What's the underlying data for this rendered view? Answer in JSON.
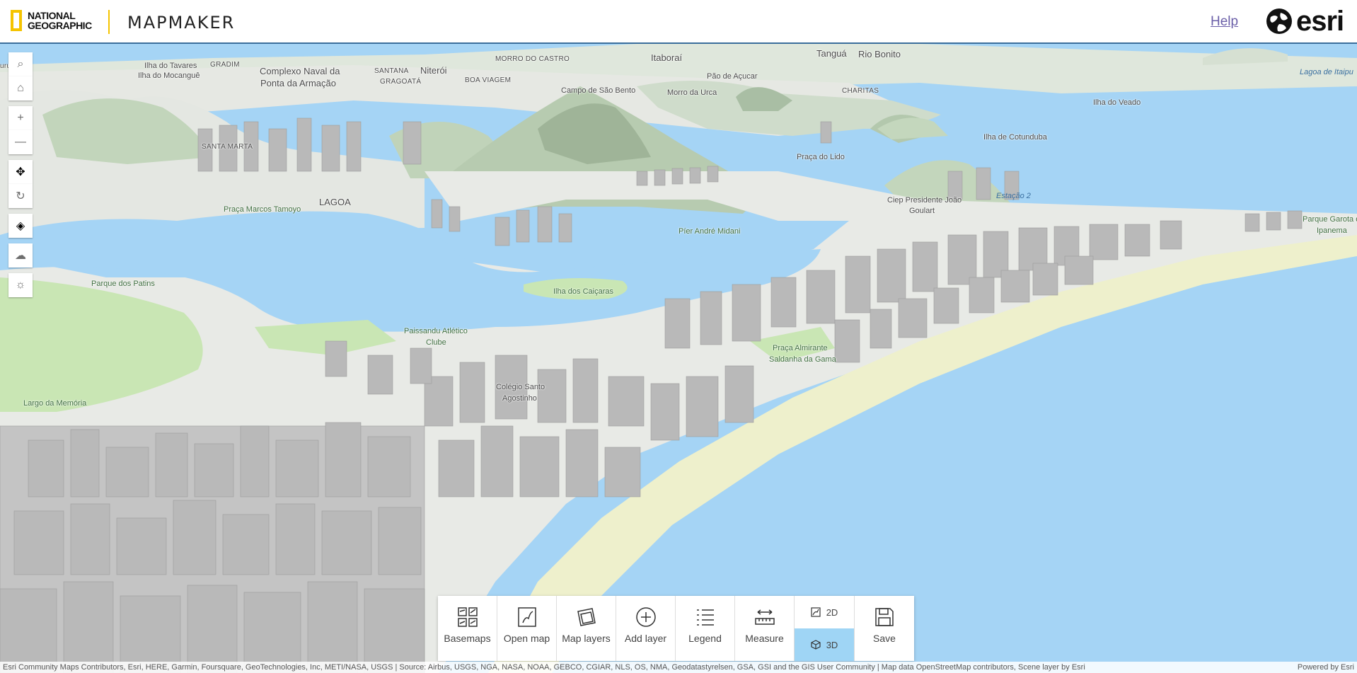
{
  "header": {
    "ng_line1": "NATIONAL",
    "ng_line2": "GEOGRAPHIC",
    "app_title": "MAPMAKER",
    "help_link": "Help",
    "esri_text": "esri"
  },
  "nav_tools": [
    {
      "name": "search-icon",
      "glyph": "⌕"
    },
    {
      "name": "home-icon",
      "glyph": "⌂"
    },
    {
      "name": "zoom-in-icon",
      "glyph": "+"
    },
    {
      "name": "zoom-out-icon",
      "glyph": "—"
    },
    {
      "name": "pan-icon",
      "glyph": "✥"
    },
    {
      "name": "rotate-icon",
      "glyph": "↻"
    },
    {
      "name": "compass-icon",
      "glyph": "◈"
    },
    {
      "name": "weather-icon",
      "glyph": "☁"
    },
    {
      "name": "daylight-icon",
      "glyph": "☼"
    }
  ],
  "toolbar": {
    "basemaps": "Basemaps",
    "open_map": "Open map",
    "map_layers": "Map layers",
    "add_layer": "Add layer",
    "legend": "Legend",
    "measure": "Measure",
    "view_2d": "2D",
    "view_3d": "3D",
    "save": "Save",
    "active_view": "3D"
  },
  "map_labels": [
    "urubaíba",
    "Ilha do Tavares",
    "GRADIM",
    "Ilha do Mocanguê",
    "Complexo Naval da",
    "Ponta da Armação",
    "SANTANA",
    "Niterói",
    "GRAGOATÁ",
    "MORRO DO CASTRO",
    "BOA VIAGEM",
    "Itaboraí",
    "Pão de Açucar",
    "Campo de São Bento",
    "Morro da Urca",
    "Tanguá",
    "Rio Bonito",
    "CHARITAS",
    "Lagoa de Itaipu",
    "Ilha do Veado",
    "Ilha de Cotunduba",
    "SANTA MARTA",
    "Praça do Lido",
    "LAGOA",
    "Praça Marcos Tamoyo",
    "Ciep Presidente João",
    "Goulart",
    "Estação 2",
    "Píer André Midani",
    "Parque Garota de",
    "Ipanema",
    "Parque dos Patins",
    "Ilha dos Caiçaras",
    "Paissandu Atlético",
    "Clube",
    "Praça Almirante",
    "Saldanha da Gama",
    "Colégio Santo",
    "Agostinho",
    "Largo da Memória"
  ],
  "attribution": {
    "left": "Esri Community Maps Contributors, Esri, HERE, Garmin, Foursquare, GeoTechnologies, Inc, METI/NASA, USGS | Source: Airbus, USGS, NGA, NASA, NOAA, GEBCO, CGIAR, NLS, OS, NMA, Geodatastyrelsen, GSA, GSI and the GIS User Community | Map data OpenStreetMap contributors, Scene layer by Esri",
    "right": "Powered by Esri"
  },
  "colors": {
    "water": "#a5d4f5",
    "land": "#e8eae6",
    "mountain": "#c7d8c0",
    "park": "#c9e6b4",
    "beach": "#eef0cc",
    "buildings": "#b9b9b9",
    "accent": "#f5c400",
    "active_toggle": "#9fd5f5"
  }
}
